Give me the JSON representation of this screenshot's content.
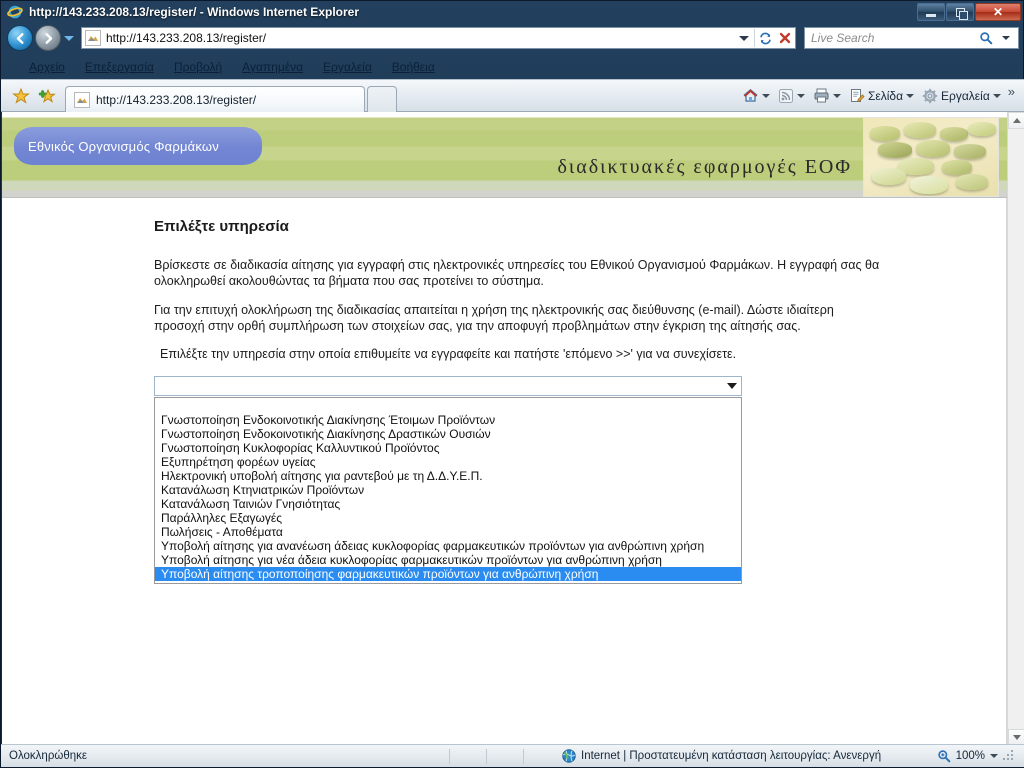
{
  "window": {
    "title": "http://143.233.208.13/register/ - Windows Internet Explorer",
    "minimize_label": "Ελαχιστοποίηση",
    "restore_label": "Επαναφορά",
    "close_label": "Κλείσιμο"
  },
  "navigation": {
    "back_label": "Πίσω",
    "forward_label": "Εμπρός",
    "recent_pages_label": "Πρόσφατες σελίδες",
    "address_value": "http://143.233.208.13/register/",
    "refresh_label": "Ανανέωση",
    "stop_label": "Διακοπή",
    "search_placeholder": "Live Search",
    "search_value": ""
  },
  "menubar": {
    "items": [
      {
        "label": "Αρχείο",
        "accel": "Α"
      },
      {
        "label": "Επεξεργασία",
        "accel": "Ε"
      },
      {
        "label": "Προβολή",
        "accel": "Π"
      },
      {
        "label": "Αγαπημένα",
        "accel": "γ"
      },
      {
        "label": "Εργαλεία",
        "accel": "Ε"
      },
      {
        "label": "Βοήθεια",
        "accel": "Β"
      }
    ]
  },
  "commandbar": {
    "favorites_center_label": "Κέντρο αγαπημένων",
    "add_favorite_label": "Προσθήκη στα αγαπημένα",
    "tabs": [
      {
        "label": "http://143.233.208.13/register/",
        "active": true
      }
    ],
    "new_tab_label": "Νέα καρτέλα",
    "right_buttons": [
      {
        "label": "",
        "icon": "home-icon",
        "has_caret": true
      },
      {
        "label": "",
        "icon": "rss-feed-icon",
        "has_caret": true
      },
      {
        "label": "",
        "icon": "print-icon",
        "has_caret": true
      },
      {
        "label": "Σελίδα",
        "icon": "page-icon",
        "has_caret": true
      },
      {
        "label": "Εργαλεία",
        "icon": "gear-icon",
        "has_caret": true
      }
    ],
    "overflow_label": "»"
  },
  "banner": {
    "org_badge": "Εθνικός Οργανισμός Φαρμάκων",
    "slogan": "διαδικτυακές εφαρμογές ΕΟΦ",
    "photo_alt": "pills-photo"
  },
  "content": {
    "title": "Επιλέξτε υπηρεσία",
    "paragraphs": [
      "Βρίσκεστε σε διαδικασία αίτησης για εγγραφή στις ηλεκτρονικές υπηρεσίες του Εθνικού Οργανισμού Φαρμάκων. Η εγγραφή σας θα ολοκληρωθεί ακολουθώντας τα βήματα που σας προτείνει το σύστημα.",
      "Για την επιτυχή ολοκλήρωση της διαδικασίας απαιτείται η χρήση της ηλεκτρονικής σας διεύθυνσης (e-mail). Δώστε ιδιαίτερη προσοχή στην ορθή συμπλήρωση των στοιχείων σας, για την αποφυγή προβλημάτων στην έγκριση της αίτησής σας.",
      "Επιλέξτε την υπηρεσία στην οποία επιθυμείτε να εγγραφείτε και πατήστε 'επόμενο >>' για να συνεχίσετε."
    ],
    "service_select": {
      "name": "service-select",
      "selected_value": "",
      "expanded": true,
      "highlight_color": "#2a8cf0",
      "options": [
        "",
        "Γνωστοποίηση Ενδοκοινοτικής Διακίνησης Έτοιμων Προϊόντων",
        "Γνωστοποίηση Ενδοκοινοτικής Διακίνησης Δραστικών Ουσιών",
        "Γνωστοποίηση Κυκλοφορίας Καλλυντικού Προϊόντος",
        "Εξυπηρέτηση φορέων υγείας",
        "Ηλεκτρονική υποβολή αίτησης για ραντεβού με τη Δ.Δ.Υ.Ε.Π.",
        "Κατανάλωση Κτηνιατρικών Προϊόντων",
        "Κατανάλωση Ταινιών Γνησιότητας",
        "Παράλληλες Εξαγωγές",
        "Πωλήσεις - Αποθέματα",
        "Υποβολή αίτησης για ανανέωση άδειας κυκλοφορίας φαρμακευτικών προϊόντων για ανθρώπινη χρήση",
        "Υποβολή αίτησης για νέα άδεια κυκλοφορίας φαρμακευτικών προϊόντων για ανθρώπινη χρήση",
        "Υποβολή αίτησης τροποποίησης φαρμακευτικών προϊόντων για ανθρώπινη χρήση"
      ],
      "highlighted_index": 12
    }
  },
  "statusbar": {
    "status": "Ολοκληρώθηκε",
    "zone": "Internet | Προστατευμένη κατάσταση λειτουργίας: Ανενεργή",
    "zoom": "100%"
  },
  "colors": {
    "banner_green": "#bccd7c",
    "badge_blue": "#7286d3",
    "selection_blue": "#2a8cf0",
    "close_red": "#c94a34"
  }
}
